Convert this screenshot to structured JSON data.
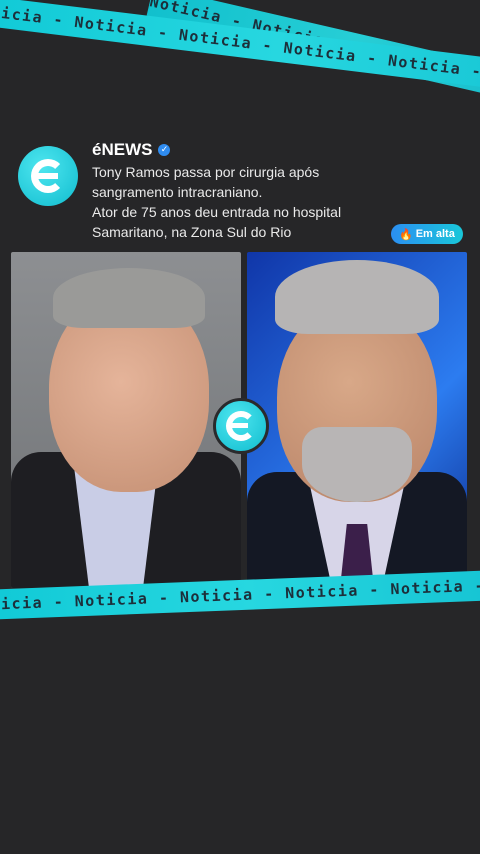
{
  "ribbon": {
    "text": "Noticia - Noticia - Noticia - Noticia - Noticia - Noticia - Noticia",
    "bottom_text": "oticia - Noticia - Noticia - Noticia - Noticia - Noticia -"
  },
  "post": {
    "brand": "éNEWS",
    "headline_line1": "Tony Ramos passa por cirurgia após",
    "headline_line2": "sangramento intracraniano.",
    "headline_line3": "Ator de 75 anos deu entrada no hospital",
    "headline_line4": "Samaritano, na Zona Sul do Rio",
    "trend_label": "Em alta",
    "trend_icon": "fire-icon"
  },
  "colors": {
    "background": "#262628",
    "accent": "#19c7d9",
    "verified": "#2f8cf0"
  }
}
